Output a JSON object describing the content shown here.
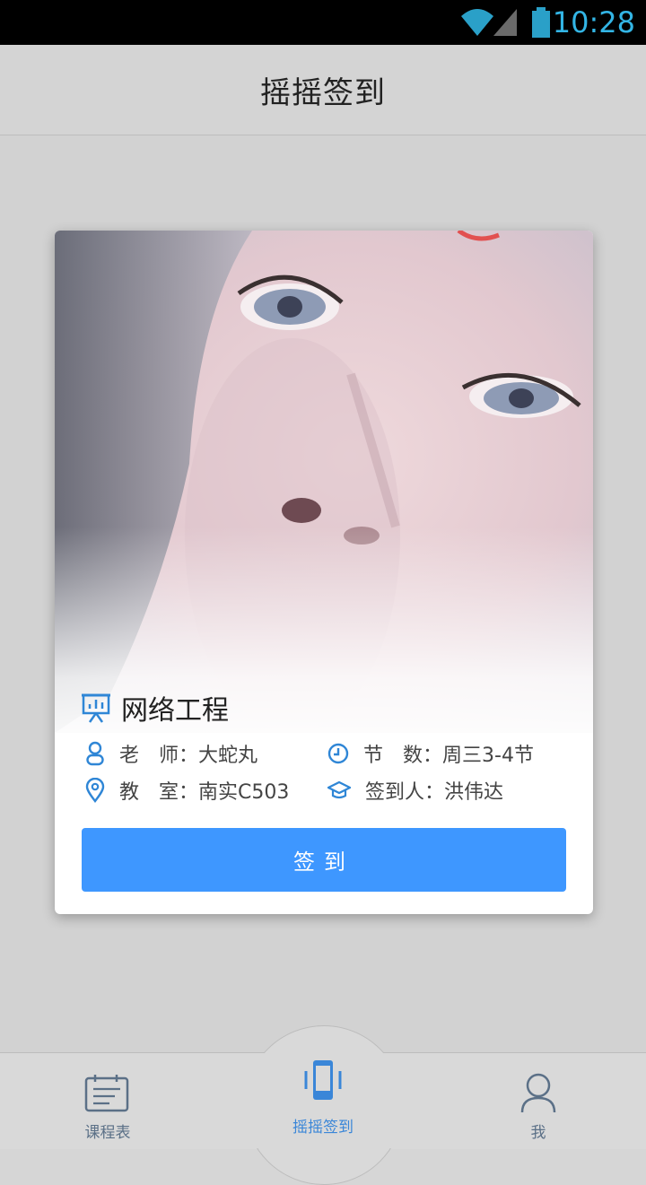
{
  "status_bar": {
    "time": "10:28",
    "icons": [
      "wifi-icon",
      "signal-icon",
      "battery-icon"
    ]
  },
  "header": {
    "title": "摇摇签到"
  },
  "card": {
    "course_icon": "presentation-chart-icon",
    "course_name": "网络工程",
    "teacher_label": "老　师：",
    "teacher_value": "大蛇丸",
    "periods_label": "节　数：",
    "periods_value": "周三3-4节",
    "room_label": "教　室：",
    "room_value": "南实C503",
    "signer_label": "签到人：",
    "signer_value": "洪伟达",
    "signin_button": "签到"
  },
  "bottom_nav": {
    "items": [
      {
        "label": "课程表",
        "icon": "calendar-icon"
      },
      {
        "label": "摇摇签到",
        "icon": "phone-shake-icon",
        "active": true
      },
      {
        "label": "我",
        "icon": "user-icon"
      }
    ]
  },
  "colors": {
    "accent": "#3e97ff",
    "status_time": "#33b5e5",
    "nav_inactive": "#5b7087",
    "nav_active": "#3a86d8"
  }
}
